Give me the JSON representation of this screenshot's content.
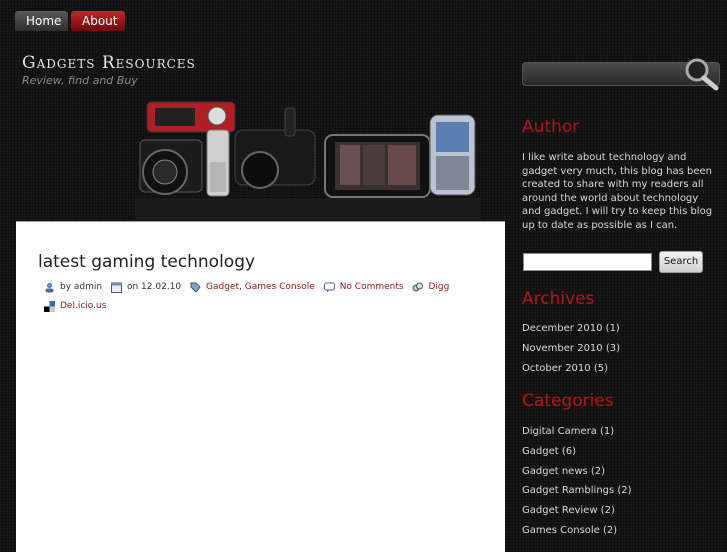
{
  "nav": {
    "home": "Home",
    "about": "About"
  },
  "site": {
    "title": "Gadgets Resources",
    "description": "Review, find and Buy"
  },
  "post": {
    "title": "latest gaming technology",
    "author": "by admin",
    "date": "on 12.02.10",
    "category_1": "Gadget",
    "category_sep": ",",
    "category_2": "Games Console",
    "comments": "No Comments",
    "digg": "Digg",
    "delicious": "Del.icio.us"
  },
  "sidebar": {
    "author_heading": "Author",
    "author_text": "I like write about technology and gadget very much, this blog has been created to share with my readers all around the world about technology and gadget. I will try to keep this blog up to date as possible as I can.",
    "search_button": "Search",
    "archives_heading": "Archives",
    "archives": [
      "December 2010 (1)",
      "November 2010 (3)",
      "October 2010 (5)"
    ],
    "categories_heading": "Categories",
    "categories": [
      "Digital Camera (1)",
      "Gadget (6)",
      "Gadget news (2)",
      "Gadget Ramblings (2)",
      "Gadget Review (2)",
      "Games Console (2)"
    ]
  },
  "colors": {
    "accent_red": "#b3161b",
    "link_red": "#8b1a1a",
    "nav_active": "#a3161b"
  }
}
